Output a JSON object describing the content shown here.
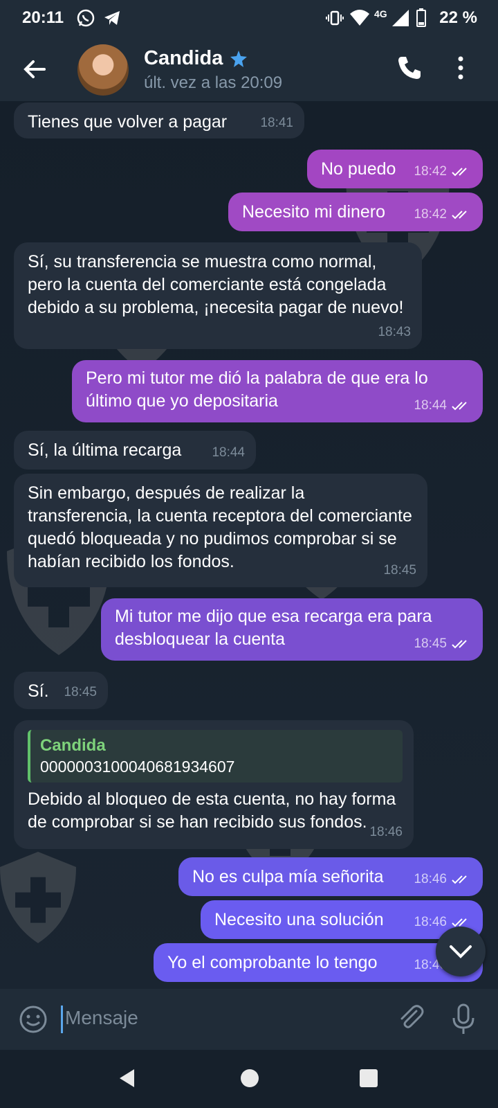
{
  "status_bar": {
    "time": "20:11",
    "battery": "22 %",
    "network": "4G"
  },
  "header": {
    "name": "Candida",
    "status": "últ. vez a las 20:09"
  },
  "colors": {
    "outgoing_top": "#a346c2",
    "outgoing_bottom": "#6a5cf0",
    "incoming": "#252f3c",
    "quote_bar": "#61c16b"
  },
  "messages": [
    {
      "text": "Tienes que volver a pagar",
      "time": "18:41",
      "dir": "in"
    },
    {
      "text": "No puedo",
      "time": "18:42",
      "dir": "out"
    },
    {
      "text": "Necesito mi dinero",
      "time": "18:42",
      "dir": "out"
    },
    {
      "text": "Sí, su transferencia se muestra como normal, pero la cuenta del comerciante está congelada debido a su problema, ¡necesita pagar de nuevo!",
      "time": "18:43",
      "dir": "in"
    },
    {
      "text": "Pero mi tutor me dió la palabra de que era lo último que yo depositaria",
      "time": "18:44",
      "dir": "out"
    },
    {
      "text": "Sí, la última recarga",
      "time": "18:44",
      "dir": "in"
    },
    {
      "text": "Sin embargo, después de realizar la transferencia, la cuenta receptora del comerciante quedó bloqueada y no pudimos comprobar si se habían recibido los fondos.",
      "time": "18:45",
      "dir": "in"
    },
    {
      "text": "Mi tutor me dijo que esa recarga era para desbloquear la cuenta",
      "time": "18:45",
      "dir": "out"
    },
    {
      "text": "Sí.",
      "time": "18:45",
      "dir": "in"
    },
    {
      "text": "Debido al bloqueo de esta cuenta, no hay forma de comprobar si se han recibido sus fondos.",
      "time": "18:46",
      "dir": "in",
      "quote": {
        "name": "Candida",
        "text": "0000003100040681934607"
      }
    },
    {
      "text": "No es culpa mía señorita",
      "time": "18:46",
      "dir": "out"
    },
    {
      "text": "Necesito una solución",
      "time": "18:46",
      "dir": "out"
    },
    {
      "text": "Yo el comprobante lo tengo",
      "time": "18:46",
      "dir": "out"
    }
  ],
  "composer": {
    "placeholder": "Mensaje"
  },
  "icons": [
    "back-arrow-icon",
    "verified-star-icon",
    "phone-icon",
    "more-vert-icon",
    "emoji-icon",
    "attach-icon",
    "mic-icon",
    "chevron-down-icon",
    "nav-back-icon",
    "nav-home-icon",
    "nav-recents-icon"
  ]
}
